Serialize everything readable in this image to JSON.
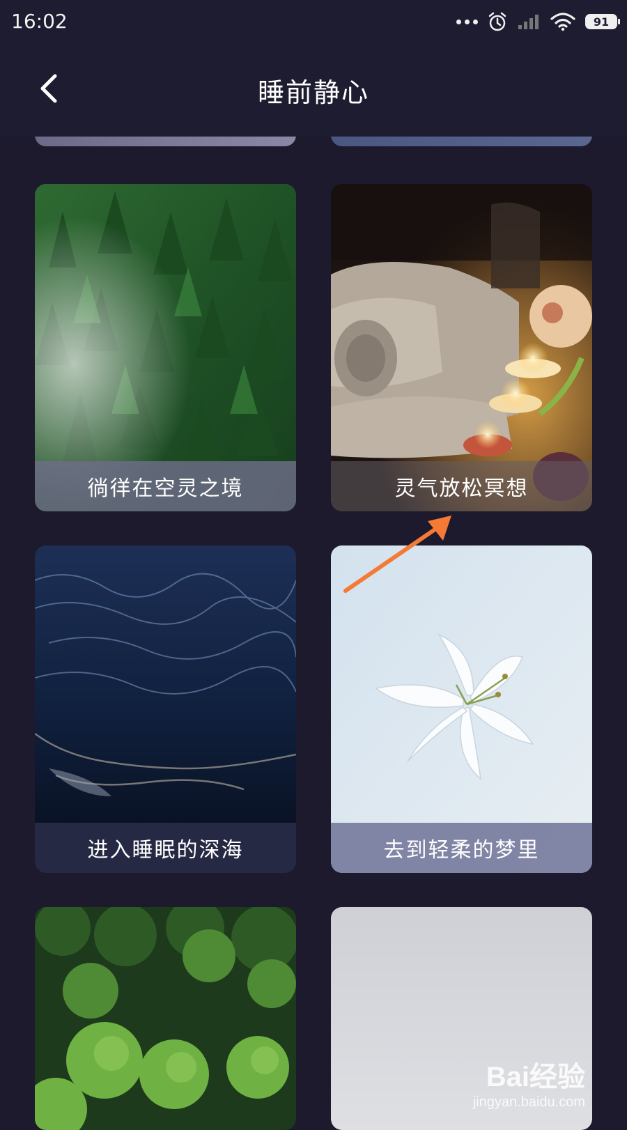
{
  "status_bar": {
    "time": "16:02",
    "battery": "91",
    "icons": [
      "more-dots-icon",
      "alarm-icon",
      "signal-icon",
      "wifi-icon",
      "battery-icon"
    ]
  },
  "header": {
    "title": "睡前静心",
    "back_icon": "chevron-left-icon"
  },
  "cards": [
    {
      "caption": "徜徉在空灵之境",
      "image": "misty pine forest"
    },
    {
      "caption": "灵气放松冥想",
      "image": "towels and candles"
    },
    {
      "caption": "进入睡眠的深海",
      "image": "dark ocean waves"
    },
    {
      "caption": "去到轻柔的梦里",
      "image": "white lily"
    },
    {
      "caption": "",
      "image": "green tree canopy"
    },
    {
      "caption": "",
      "image": "snowy landscape"
    }
  ],
  "annotation": {
    "arrow_color": "#f47a36"
  },
  "watermark": {
    "brand": "Bai经验",
    "url": "jingyan.baidu.com"
  },
  "colors": {
    "background": "#1c1a2c",
    "header": "#1e1c30",
    "accent_orange": "#f47a36"
  }
}
